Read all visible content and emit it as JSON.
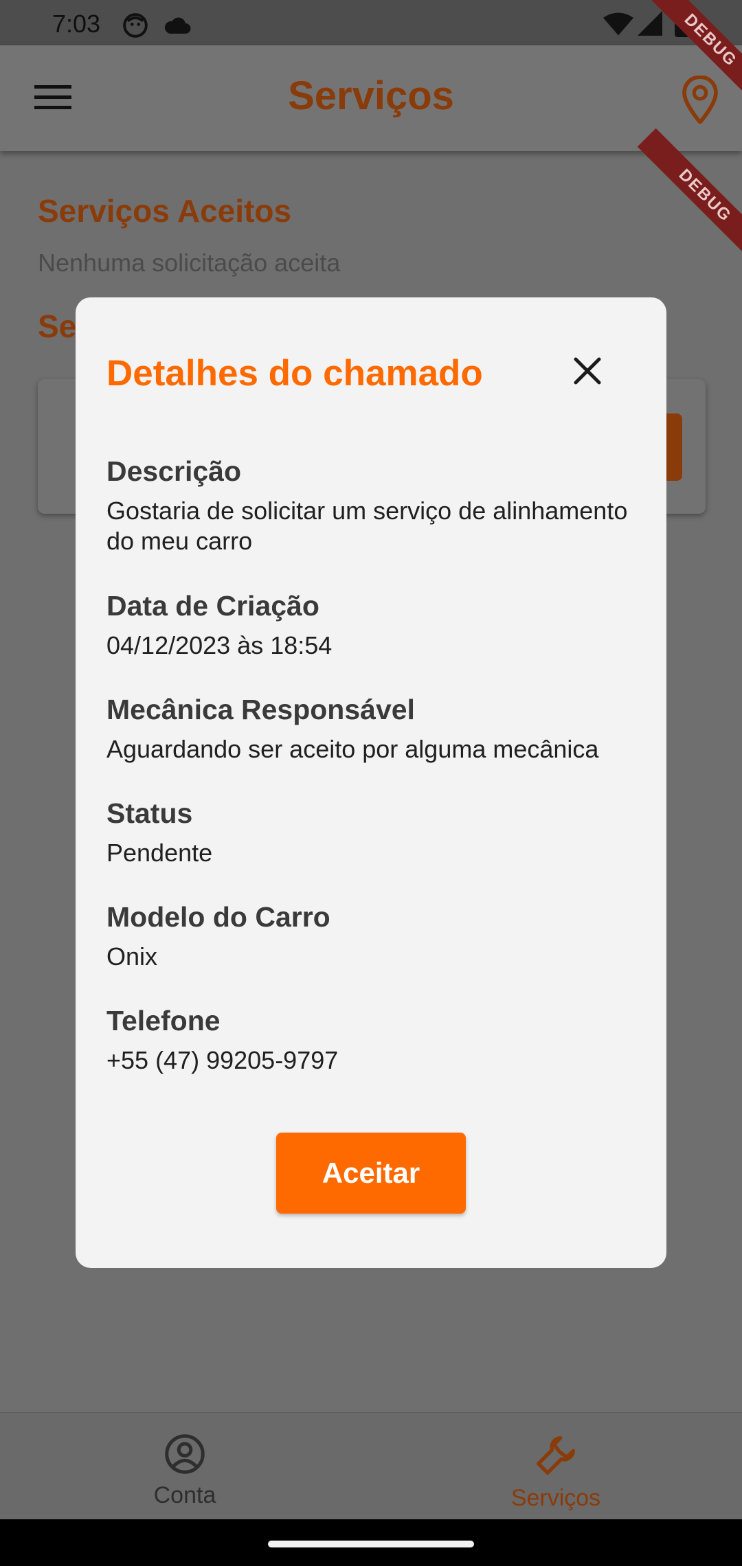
{
  "status_bar": {
    "time": "7:03"
  },
  "app_bar": {
    "title": "Serviços"
  },
  "debug_banner": "DEBUG",
  "background": {
    "accepted_title": "Serviços Aceitos",
    "accepted_empty": "Nenhuma solicitação aceita",
    "second_section_partial": "Se"
  },
  "dialog": {
    "title": "Detalhes do chamado",
    "fields": [
      {
        "label": "Descrição",
        "value": "Gostaria de solicitar um serviço de alinhamento do meu carro"
      },
      {
        "label": "Data de Criação",
        "value": "04/12/2023 às 18:54"
      },
      {
        "label": "Mecânica Responsável",
        "value": "Aguardando ser aceito por alguma mecânica"
      },
      {
        "label": "Status",
        "value": "Pendente"
      },
      {
        "label": "Modelo do Carro",
        "value": "Onix"
      },
      {
        "label": "Telefone",
        "value": "+55 (47) 99205-9797"
      }
    ],
    "accept_label": "Aceitar"
  },
  "bottom_nav": {
    "items": [
      {
        "label": "Conta",
        "icon": "account-circle-icon"
      },
      {
        "label": "Serviços",
        "icon": "wrench-icon",
        "active": true
      }
    ]
  },
  "colors": {
    "accent": "#ff6a00",
    "accent_dimmed": "#8a3b0a",
    "scrim": "#6f6f6f",
    "dialog_bg": "#f3f3f3"
  }
}
